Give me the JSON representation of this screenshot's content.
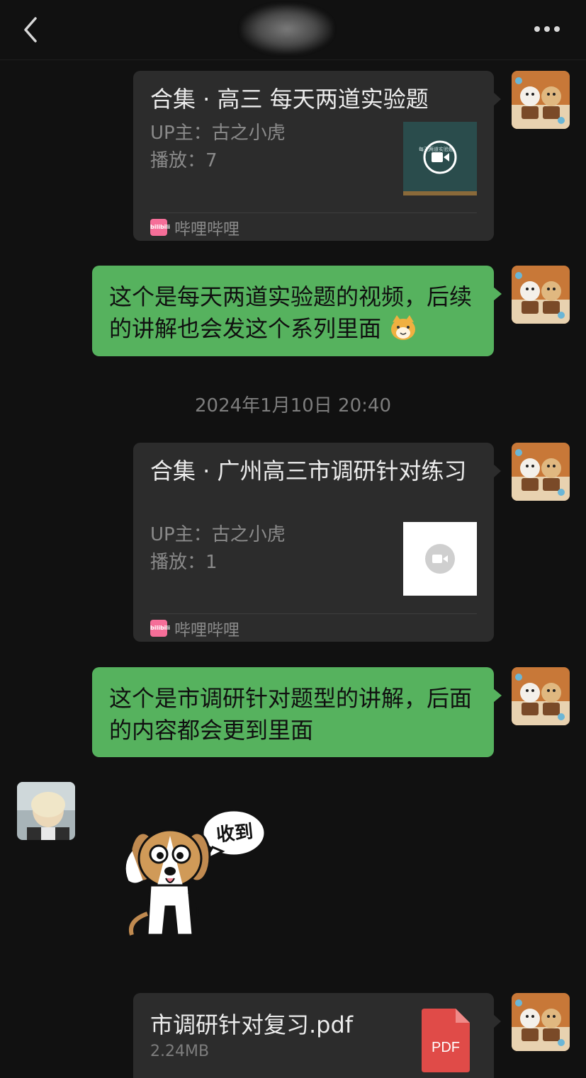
{
  "header": {
    "back_icon": "chevron-left-icon",
    "more_icon": "more-dots-icon"
  },
  "messages": {
    "card1": {
      "title": "合集 · 高三 每天两道实验题",
      "up": "UP主：古之小虎",
      "plays": "播放：7",
      "thumb_text": "每天两道实验题",
      "source": "哔哩哔哩",
      "logo_text": "bilibili"
    },
    "bubble1": {
      "text": "这个是每天两道实验题的视频，后续的讲解也会发这个系列里面",
      "emoji": "cat-face-icon"
    },
    "timestamp": "2024年1月10日 20:40",
    "card2": {
      "title": "合集 · 广州高三市调研针对练习",
      "up": "UP主：古之小虎",
      "plays": "播放：1",
      "source": "哔哩哔哩",
      "logo_text": "bilibili"
    },
    "bubble2": {
      "text": "这个是市调研针对题型的讲解，后面的内容都会更到里面"
    },
    "sticker": {
      "speech": "收到"
    },
    "file": {
      "name": "市调研针对复习.pdf",
      "size": "2.24MB",
      "badge": "PDF"
    }
  },
  "colors": {
    "background": "#111111",
    "card": "#2c2c2c",
    "bubble_green": "#56b25e",
    "pdf_red": "#e04b48",
    "bili_pink": "#f56e98"
  }
}
